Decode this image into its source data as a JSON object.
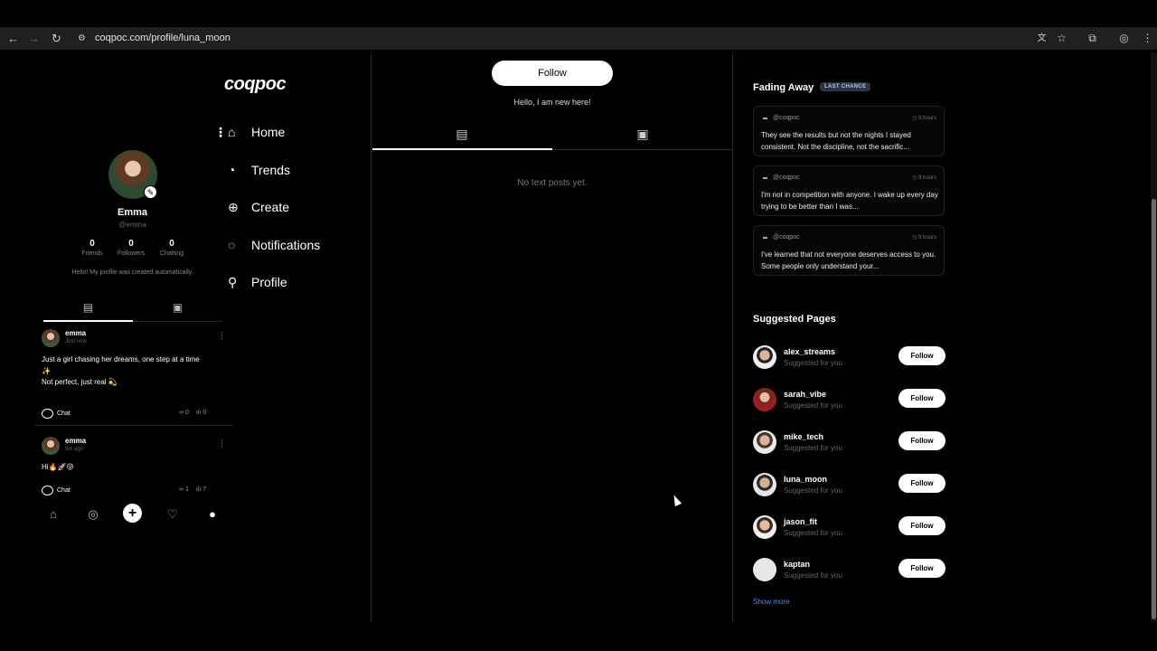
{
  "browser": {
    "url": "coqpoc.com/profile/luna_moon",
    "nav_icons": [
      "back-arrow",
      "forward-arrow",
      "reload",
      "site-info"
    ],
    "right_icons": [
      "translate",
      "bookmark-star",
      "extensions",
      "account",
      "menu-dots"
    ]
  },
  "left_nav": {
    "logo": "coqpoc",
    "items": [
      {
        "label": "Home",
        "icon": "home-icon"
      },
      {
        "label": "Trends",
        "icon": "trends-icon"
      },
      {
        "label": "Create",
        "icon": "create-icon"
      },
      {
        "label": "Notifications",
        "icon": "notifications-icon"
      },
      {
        "label": "Profile",
        "icon": "profile-icon"
      }
    ]
  },
  "mini_profile": {
    "name": "Emma",
    "handle": "@emma",
    "stats": [
      {
        "value": "0",
        "label": "Friends"
      },
      {
        "value": "0",
        "label": "Followers"
      },
      {
        "value": "0",
        "label": "Chatting"
      }
    ],
    "bio": "Hello! My profile was created automatically.",
    "posts": [
      {
        "user": "emma",
        "time": "Just now",
        "text_lines": [
          "Just a girl chasing her dreams, one step at a time",
          "✨",
          "Not perfect, just real 💫"
        ],
        "chat_label": "Chat",
        "shares": "0",
        "views": "0"
      },
      {
        "user": "emma",
        "time": "9m ago",
        "text_lines": [
          "Hi🔥🚀😜"
        ],
        "chat_label": "Chat",
        "shares": "1",
        "views": "7"
      }
    ]
  },
  "center": {
    "follow_label": "Follow",
    "bio": "Hello, I am new here!",
    "empty_message": "No text posts yet."
  },
  "right": {
    "fading_title": "Fading Away",
    "fading_badge": "LAST CHANCE",
    "fading_cards": [
      {
        "author": "@coqpoc",
        "time": "9 hours",
        "text": "They see the results but not the nights I stayed consistent. Not the discipline, not the sacrific..."
      },
      {
        "author": "@coqpoc",
        "time": "9 hours",
        "text": "I'm not in competition with anyone. I wake up every day trying to be better than I was..."
      },
      {
        "author": "@coqpoc",
        "time": "9 hours",
        "text": "I've learned that not everyone deserves access to you. Some people only understand your..."
      }
    ],
    "suggested_title": "Suggested Pages",
    "suggested": [
      {
        "name": "alex_streams",
        "sub": "Suggested for you",
        "button": "Follow"
      },
      {
        "name": "sarah_vibe",
        "sub": "Suggested for you",
        "button": "Follow"
      },
      {
        "name": "mike_tech",
        "sub": "Suggested for you",
        "button": "Follow"
      },
      {
        "name": "luna_moon",
        "sub": "Suggested for you",
        "button": "Follow"
      },
      {
        "name": "jason_fit",
        "sub": "Suggested for you",
        "button": "Follow"
      },
      {
        "name": "kaptan",
        "sub": "Suggested for you",
        "button": "Follow"
      }
    ],
    "show_more": "Show more"
  }
}
